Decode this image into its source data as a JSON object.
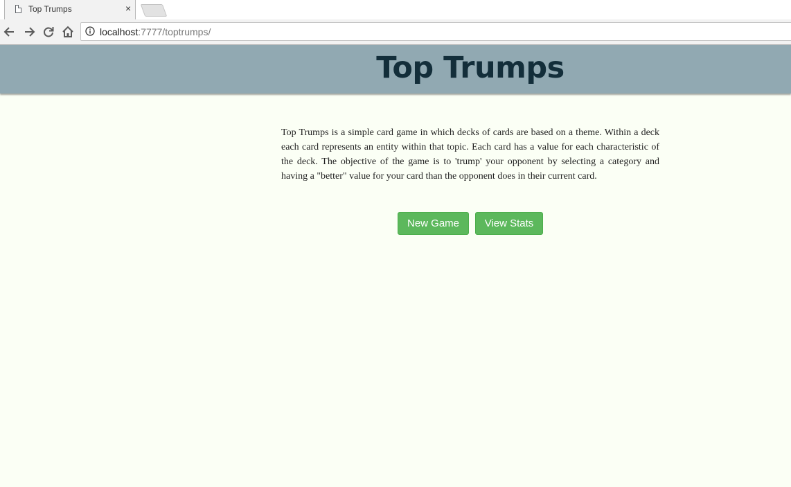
{
  "browser": {
    "tab_title": "Top Trumps",
    "tab_close": "×",
    "url_host": "localhost",
    "url_rest": ":7777/toptrumps/"
  },
  "header": {
    "title": "Top Trumps",
    "background_color": "#91a9b2",
    "title_color": "#132e3a"
  },
  "main": {
    "intro_text": "Top Trumps is a simple card game in which decks of cards are based on a theme. Within a deck each card represents an entity within that topic. Each card has a value for each characteristic of the deck. The objective of the game is to 'trump' your opponent by selecting a category and having a \"better\" value for your card than the opponent does in their current card.",
    "buttons": {
      "new_game": "New Game",
      "view_stats": "View Stats",
      "color": "#5cb85c"
    }
  },
  "icons": {
    "tab": "page-icon",
    "back": "back-arrow-icon",
    "forward": "forward-arrow-icon",
    "reload": "reload-icon",
    "home": "home-icon",
    "info": "info-icon"
  }
}
